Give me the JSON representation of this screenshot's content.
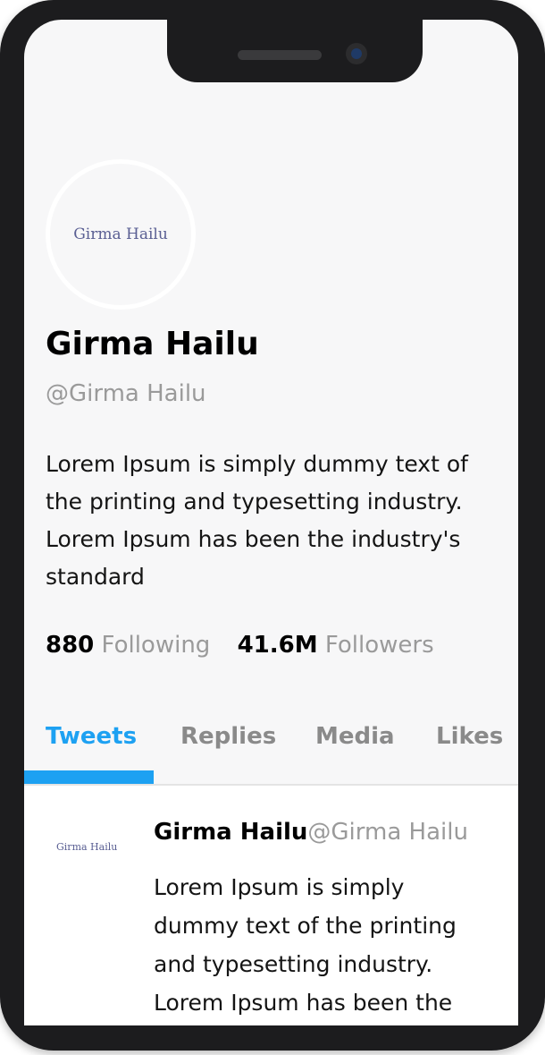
{
  "profile": {
    "avatar_text": "Girma Hailu",
    "name": "Girma Hailu",
    "handle": "@Girma Hailu",
    "bio": "Lorem Ipsum is simply dummy text of the printing and typesetting industry. Lorem Ipsum has been the industry's standard",
    "following_count": "880",
    "following_label": "Following",
    "followers_count": "41.6M",
    "followers_label": "Followers"
  },
  "tabs": [
    {
      "label": "Tweets",
      "active": true
    },
    {
      "label": "Replies",
      "active": false
    },
    {
      "label": "Media",
      "active": false
    },
    {
      "label": "Likes",
      "active": false
    }
  ],
  "tweet": {
    "avatar_text": "Girma Hailu",
    "name": "Girma Hailu",
    "handle": "@Girma Hailu",
    "body": "Lorem Ipsum is simply dummy text of the printing and typesetting industry. Lorem Ipsum has been the"
  },
  "colors": {
    "accent": "#1da1f2",
    "muted_text": "#9a9a9a",
    "device_frame": "#1c1c1e",
    "screen_bg": "#f7f7f8"
  }
}
